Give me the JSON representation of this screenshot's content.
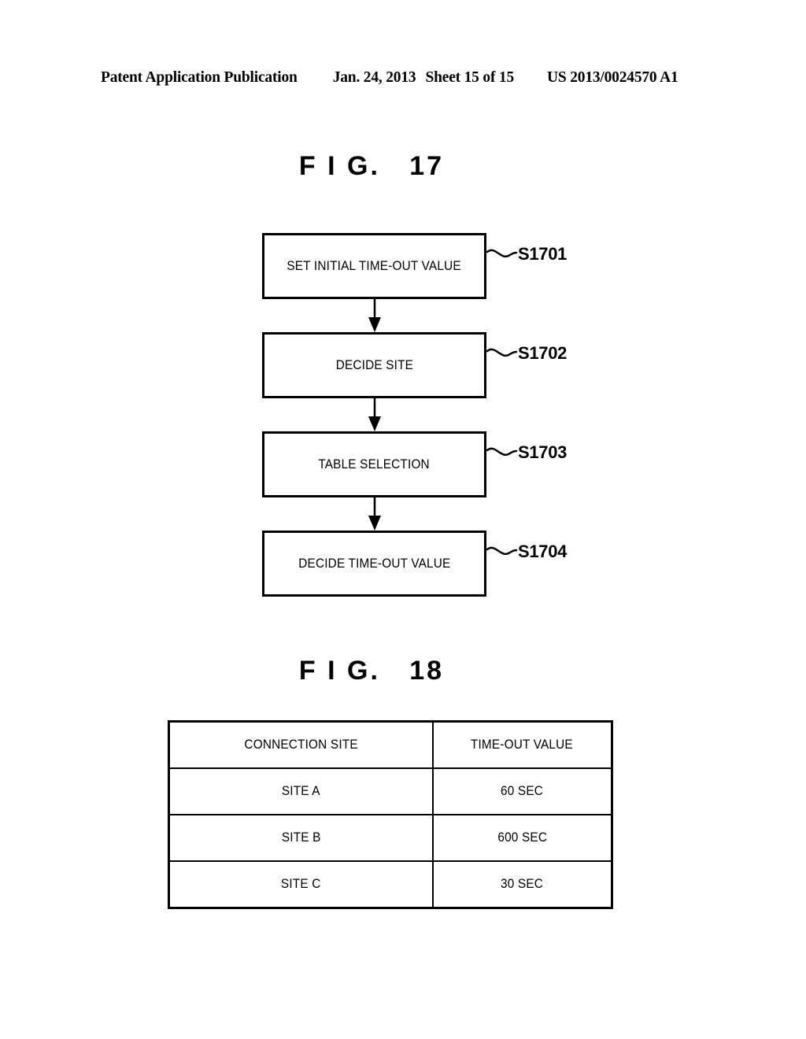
{
  "header": {
    "publication": "Patent Application Publication",
    "date": "Jan. 24, 2013",
    "sheet": "Sheet 15 of 15",
    "patent_number": "US 2013/0024570 A1"
  },
  "figures": [
    {
      "id": "fig17",
      "title": "F I G.   17",
      "type": "flowchart",
      "steps": [
        {
          "label": "SET INITIAL TIME-OUT VALUE",
          "ref": "S1701"
        },
        {
          "label": "DECIDE SITE",
          "ref": "S1702"
        },
        {
          "label": "TABLE SELECTION",
          "ref": "S1703"
        },
        {
          "label": "DECIDE TIME-OUT VALUE",
          "ref": "S1704"
        }
      ]
    },
    {
      "id": "fig18",
      "title": "F I G.   18",
      "type": "table",
      "table": {
        "columns": [
          "CONNECTION SITE",
          "TIME-OUT VALUE"
        ],
        "rows": [
          [
            "SITE A",
            "60 SEC"
          ],
          [
            "SITE B",
            "600 SEC"
          ],
          [
            "SITE C",
            "30 SEC"
          ]
        ]
      }
    }
  ],
  "colors": {
    "ink": "#000000",
    "paper": "#ffffff"
  }
}
